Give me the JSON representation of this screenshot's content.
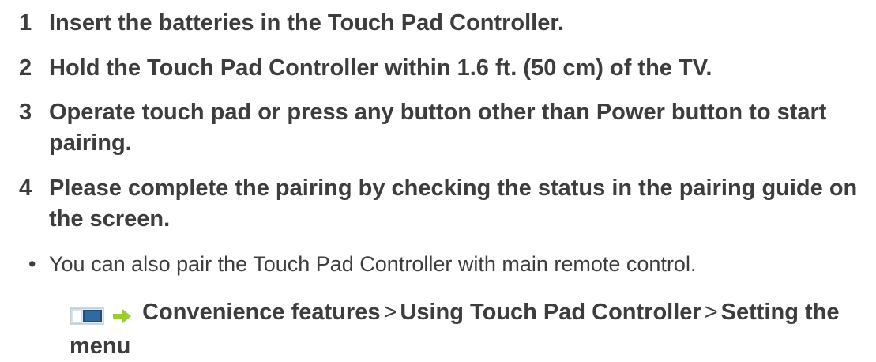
{
  "steps": [
    {
      "num": "1",
      "text": "Insert the batteries in the Touch Pad Controller."
    },
    {
      "num": "2",
      "text": "Hold the Touch Pad Controller within 1.6 ft. (50 cm) of the TV."
    },
    {
      "num": "3",
      "text": "Operate touch pad or press any button other than Power button to start pairing."
    },
    {
      "num": "4",
      "text": "Please complete the pairing by checking the status in the pairing guide on the screen."
    }
  ],
  "note": {
    "bullet": "•",
    "text": "You can also pair the Touch Pad Controller with main remote control."
  },
  "reference": {
    "icons": [
      "book-icon",
      "arrow-right-icon"
    ],
    "item1": "Convenience features",
    "sep1": ">",
    "item2": "Using Touch Pad Controller",
    "sep2": ">",
    "item3": "Setting the menu"
  },
  "colors": {
    "text": "#3d3d3d",
    "icon_blue": "#2a5a8a",
    "icon_arrow": "#9acd32"
  }
}
